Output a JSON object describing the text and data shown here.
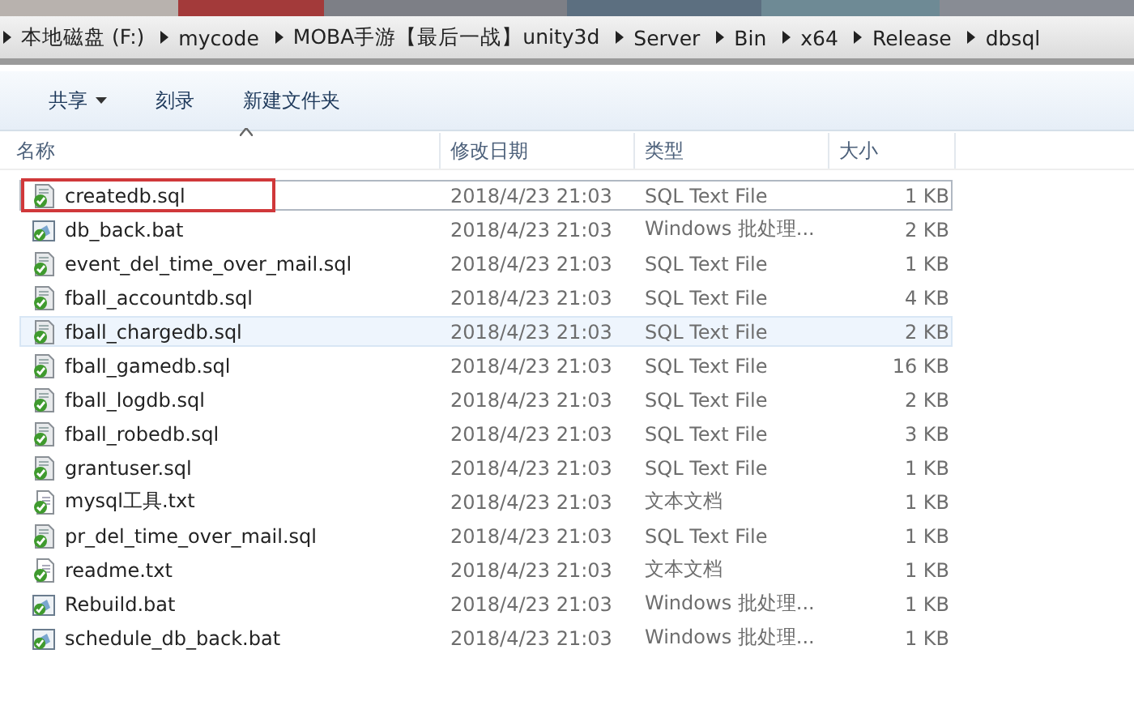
{
  "breadcrumb": [
    "本地磁盘 (F:)",
    "mycode",
    "MOBA手游【最后一战】unity3d",
    "Server",
    "Bin",
    "x64",
    "Release",
    "dbsql"
  ],
  "toolbar": [
    {
      "label": "共享",
      "dropdown": true
    },
    {
      "label": "刻录",
      "dropdown": false
    },
    {
      "label": "新建文件夹",
      "dropdown": false
    }
  ],
  "columns": [
    {
      "label": "名称",
      "sorted": true
    },
    {
      "label": "修改日期",
      "sorted": false
    },
    {
      "label": "类型",
      "sorted": false
    },
    {
      "label": "大小",
      "sorted": false
    }
  ],
  "files": [
    {
      "name": "createdb.sql",
      "date": "2018/4/23 21:03",
      "type": "SQL Text File",
      "size": "1 KB",
      "kind": "sql",
      "selected": false,
      "focused": true,
      "annotated": true
    },
    {
      "name": "db_back.bat",
      "date": "2018/4/23 21:03",
      "type": "Windows 批处理...",
      "size": "2 KB",
      "kind": "bat",
      "selected": false,
      "focused": false,
      "annotated": false
    },
    {
      "name": "event_del_time_over_mail.sql",
      "date": "2018/4/23 21:03",
      "type": "SQL Text File",
      "size": "1 KB",
      "kind": "sql",
      "selected": false,
      "focused": false,
      "annotated": false
    },
    {
      "name": "fball_accountdb.sql",
      "date": "2018/4/23 21:03",
      "type": "SQL Text File",
      "size": "4 KB",
      "kind": "sql",
      "selected": false,
      "focused": false,
      "annotated": false
    },
    {
      "name": "fball_chargedb.sql",
      "date": "2018/4/23 21:03",
      "type": "SQL Text File",
      "size": "2 KB",
      "kind": "sql",
      "selected": true,
      "focused": false,
      "annotated": false
    },
    {
      "name": "fball_gamedb.sql",
      "date": "2018/4/23 21:03",
      "type": "SQL Text File",
      "size": "16 KB",
      "kind": "sql",
      "selected": false,
      "focused": false,
      "annotated": false
    },
    {
      "name": "fball_logdb.sql",
      "date": "2018/4/23 21:03",
      "type": "SQL Text File",
      "size": "2 KB",
      "kind": "sql",
      "selected": false,
      "focused": false,
      "annotated": false
    },
    {
      "name": "fball_robedb.sql",
      "date": "2018/4/23 21:03",
      "type": "SQL Text File",
      "size": "3 KB",
      "kind": "sql",
      "selected": false,
      "focused": false,
      "annotated": false
    },
    {
      "name": "grantuser.sql",
      "date": "2018/4/23 21:03",
      "type": "SQL Text File",
      "size": "1 KB",
      "kind": "sql",
      "selected": false,
      "focused": false,
      "annotated": false
    },
    {
      "name": "mysql工具.txt",
      "date": "2018/4/23 21:03",
      "type": "文本文档",
      "size": "1 KB",
      "kind": "txt",
      "selected": false,
      "focused": false,
      "annotated": false
    },
    {
      "name": "pr_del_time_over_mail.sql",
      "date": "2018/4/23 21:03",
      "type": "SQL Text File",
      "size": "1 KB",
      "kind": "sql",
      "selected": false,
      "focused": false,
      "annotated": false
    },
    {
      "name": "readme.txt",
      "date": "2018/4/23 21:03",
      "type": "文本文档",
      "size": "1 KB",
      "kind": "txt",
      "selected": false,
      "focused": false,
      "annotated": false
    },
    {
      "name": "Rebuild.bat",
      "date": "2018/4/23 21:03",
      "type": "Windows 批处理...",
      "size": "1 KB",
      "kind": "bat",
      "selected": false,
      "focused": false,
      "annotated": false
    },
    {
      "name": "schedule_db_back.bat",
      "date": "2018/4/23 21:03",
      "type": "Windows 批处理...",
      "size": "1 KB",
      "kind": "bat",
      "selected": false,
      "focused": false,
      "annotated": false
    }
  ]
}
